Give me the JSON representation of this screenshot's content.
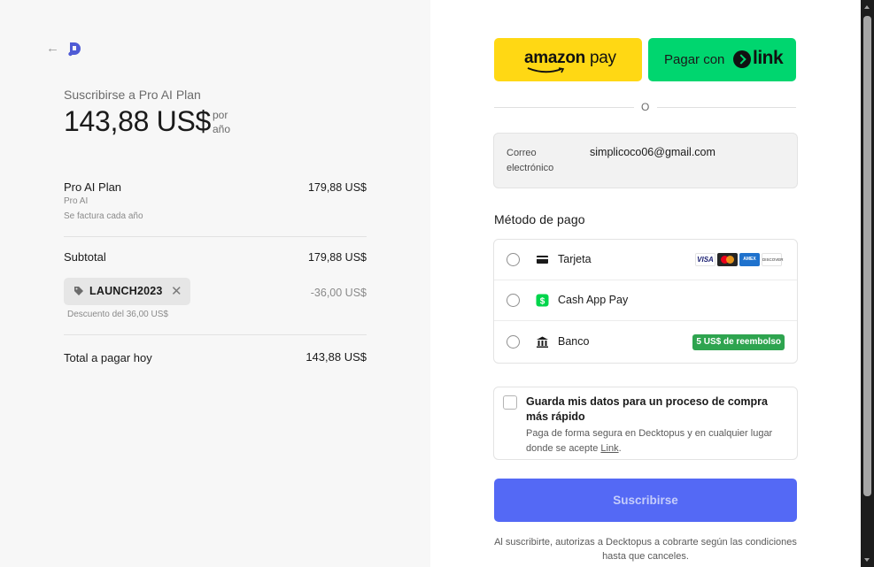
{
  "summary": {
    "back_icon": "arrow-left-icon",
    "logo_icon": "decktopus-logo-icon",
    "subscribe_to": "Suscribirse a Pro AI Plan",
    "price": "143,88 US$",
    "per_year": "por año",
    "line_item": {
      "name": "Pro AI Plan",
      "price": "179,88 US$",
      "desc": "Pro AI",
      "billing": "Se factura cada año"
    },
    "subtotal_label": "Subtotal",
    "subtotal_value": "179,88 US$",
    "promo": {
      "code": "LAUNCH2023",
      "discount_value": "-36,00 US$",
      "discount_desc": "Descuento del 36,00 US$"
    },
    "total_label": "Total a pagar hoy",
    "total_value": "143,88 US$"
  },
  "wallets": {
    "amazon_brand": "amazon",
    "amazon_pay": "pay",
    "link_prefix": "Pagar con",
    "link_word": "link",
    "separator": "O"
  },
  "email": {
    "label": "Correo electrónico",
    "value": "simplicoco06@gmail.com"
  },
  "payment": {
    "title": "Método de pago",
    "methods": [
      {
        "label": "Tarjeta",
        "icon": "credit-card-icon"
      },
      {
        "label": "Cash App Pay",
        "icon": "cash-app-icon"
      },
      {
        "label": "Banco",
        "icon": "bank-icon",
        "badge": "5 US$ de reembolso"
      }
    ],
    "card_brands": [
      "VISA",
      "Mastercard",
      "AMEX",
      "DISCOVER"
    ]
  },
  "save_info": {
    "title": "Guarda mis datos para un proceso de compra más rápido",
    "desc_prefix": "Paga de forma segura en Decktopus y en cualquier lugar donde se acepte ",
    "desc_link": "Link",
    "desc_suffix": "."
  },
  "subscribe_label": "Suscribirse",
  "terms": "Al suscribirte, autorizas a Decktopus a cobrarte según las condiciones hasta que canceles.",
  "colors": {
    "amazon": "#ffd814",
    "link": "#00d66f",
    "primary": "#5469f5",
    "cashback": "#2ea44f"
  }
}
